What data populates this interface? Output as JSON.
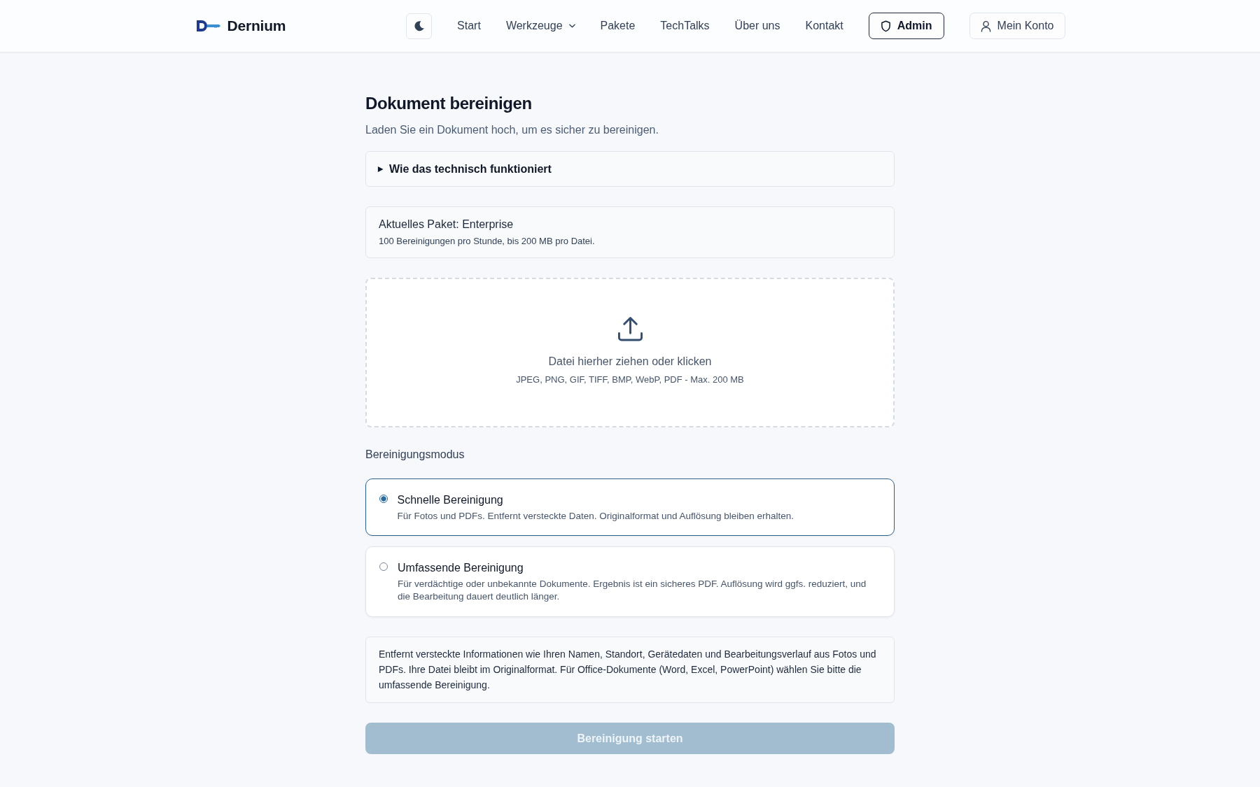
{
  "header": {
    "brand": "Dernium",
    "nav": [
      {
        "label": "Start",
        "kind": "link"
      },
      {
        "label": "Werkzeuge",
        "kind": "dropdown"
      },
      {
        "label": "Pakete",
        "kind": "link"
      },
      {
        "label": "TechTalks",
        "kind": "link"
      },
      {
        "label": "Über uns",
        "kind": "link"
      },
      {
        "label": "Kontakt",
        "kind": "link"
      }
    ],
    "admin_button": "Admin",
    "account_button": "Mein Konto"
  },
  "page": {
    "title": "Dokument bereinigen",
    "subtitle": "Laden Sie ein Dokument hoch, um es sicher zu bereinigen."
  },
  "details": {
    "summary": "Wie das technisch funktioniert",
    "expanded": false
  },
  "plan": {
    "title": "Aktuelles Paket: Enterprise",
    "description": "100 Bereinigungen pro Stunde, bis 200 MB pro Datei."
  },
  "upload": {
    "prompt": "Datei hierher ziehen oder klicken",
    "formats": "JPEG, PNG, GIF, TIFF, BMP, WebP, PDF - Max. 200 MB"
  },
  "mode": {
    "label": "Bereinigungsmodus",
    "options": [
      {
        "title": "Schnelle Bereinigung",
        "description": "Für Fotos und PDFs. Entfernt versteckte Daten. Originalformat und Auflösung bleiben erhalten.",
        "selected": true
      },
      {
        "title": "Umfassende Bereinigung",
        "description": "Für verdächtige oder unbekannte Dokumente. Ergebnis ist ein sicheres PDF. Auflösung wird ggfs. reduziert, und die Bearbeitung dauert deutlich länger.",
        "selected": false
      }
    ]
  },
  "info": "Entfernt versteckte Informationen wie Ihren Namen, Standort, Gerätedaten und Bearbeitungsverlauf aus Fotos und PDFs. Ihre Datei bleibt im Originalformat. Für Office-Dokumente (Word, Excel, PowerPoint) wählen Sie bitte die umfassende Bereinigung.",
  "submit": {
    "label": "Bereinigung starten",
    "disabled": true
  }
}
